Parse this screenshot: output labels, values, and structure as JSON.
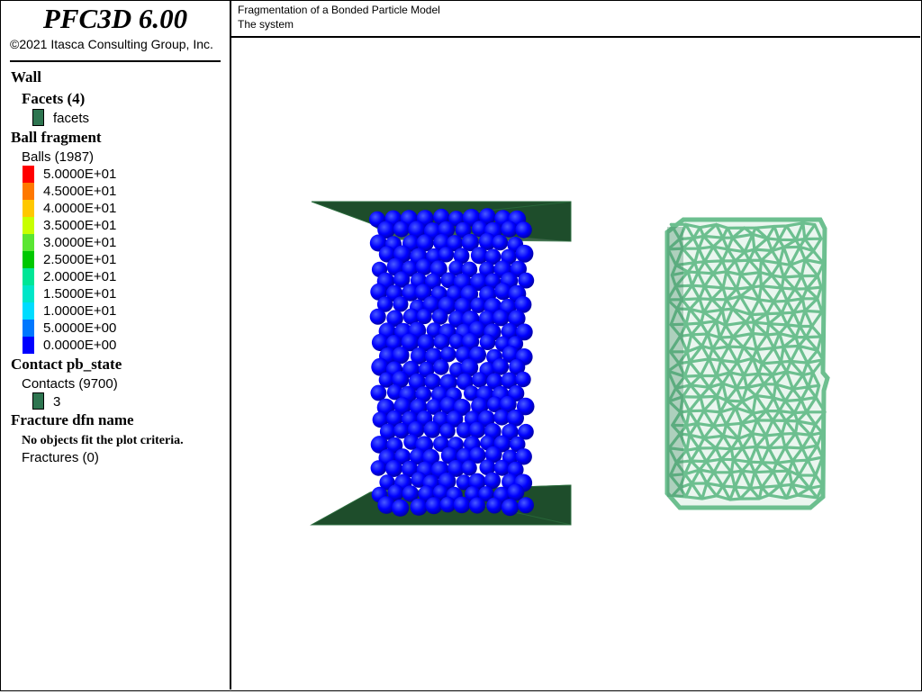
{
  "app": {
    "title": "PFC3D 6.00",
    "copyright": "©2021 Itasca Consulting Group, Inc."
  },
  "plot": {
    "title_line1": "Fragmentation of a Bonded Particle Model",
    "title_line2": "The system"
  },
  "legend": {
    "wall": {
      "header": "Wall",
      "sub_header": "Facets (4)",
      "item_label": "facets",
      "item_color": "#2e7550"
    },
    "ball": {
      "header": "Ball fragment",
      "sub_header": "Balls (1987)",
      "colorbar": [
        {
          "label": "5.0000E+01",
          "color": "#ff0000"
        },
        {
          "label": "4.5000E+01",
          "color": "#ff7800"
        },
        {
          "label": "4.0000E+01",
          "color": "#ffc800"
        },
        {
          "label": "3.5000E+01",
          "color": "#c8ff00"
        },
        {
          "label": "3.0000E+01",
          "color": "#5ae632"
        },
        {
          "label": "2.5000E+01",
          "color": "#00c800"
        },
        {
          "label": "2.0000E+01",
          "color": "#00e696"
        },
        {
          "label": "1.5000E+01",
          "color": "#00e6c8"
        },
        {
          "label": "1.0000E+01",
          "color": "#00dcff"
        },
        {
          "label": "5.0000E+00",
          "color": "#0078ff"
        },
        {
          "label": "0.0000E+00",
          "color": "#0000ff"
        }
      ]
    },
    "contact": {
      "header": "Contact pb_state",
      "sub_header": "Contacts (9700)",
      "item_label": "3",
      "item_color": "#2e7550"
    },
    "fracture": {
      "header": "Fracture dfn name",
      "message": "No objects fit the plot criteria.",
      "sub_header": "Fractures (0)"
    }
  },
  "scene": {
    "wall_color": "#1e4d2b",
    "wall_highlight": "#2a6b3c",
    "ball_color": "#0000ff",
    "bond_color": "#6cbf8f"
  }
}
